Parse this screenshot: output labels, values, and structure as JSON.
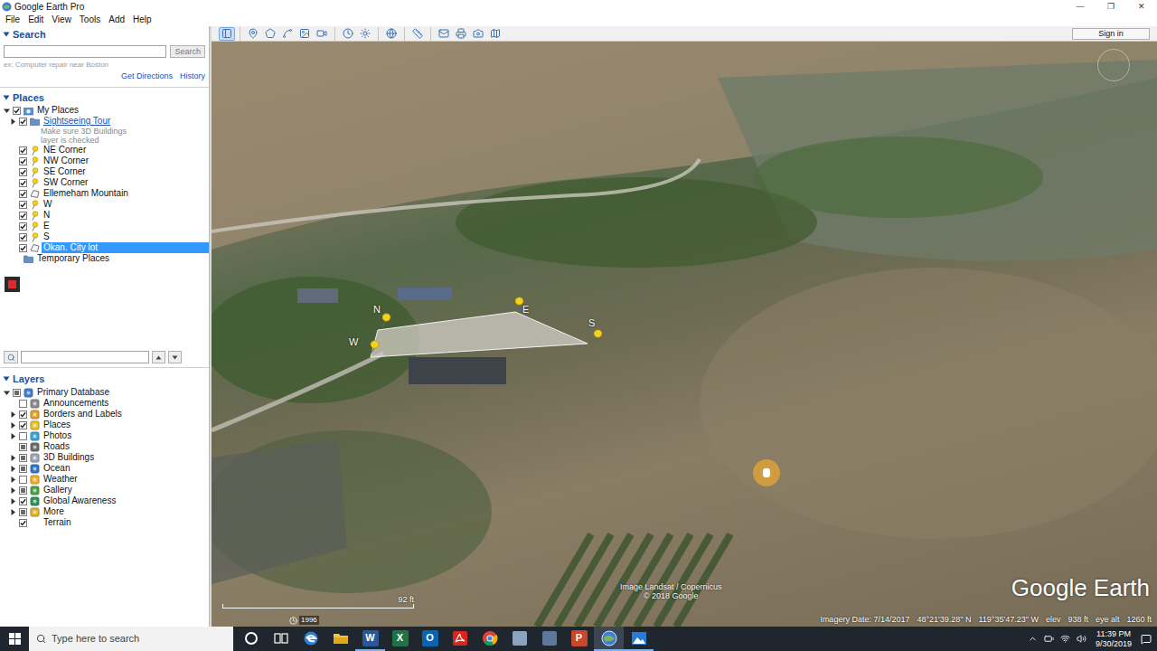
{
  "window": {
    "title": "Google Earth Pro",
    "controls": [
      "—",
      "❐",
      "✕"
    ]
  },
  "menu": [
    "File",
    "Edit",
    "View",
    "Tools",
    "Add",
    "Help"
  ],
  "search": {
    "title": "Search",
    "button": "Search",
    "hint": "ex: Computer repair near Boston",
    "links": [
      "Get Directions",
      "History"
    ]
  },
  "places": {
    "title": "Places",
    "items": [
      {
        "label": "My Places",
        "depth": 0,
        "kind": "places-folder",
        "check": "checked",
        "expandable": true,
        "expanded": true,
        "selected": false,
        "link": false,
        "note": []
      },
      {
        "label": "Sightseeing Tour",
        "depth": 1,
        "kind": "folder",
        "check": "checked",
        "expandable": true,
        "expanded": false,
        "selected": false,
        "link": true,
        "note": [
          "Make sure 3D Buildings",
          "layer is checked"
        ]
      },
      {
        "label": "NE Corner",
        "depth": 1,
        "kind": "pin",
        "check": "checked",
        "expandable": false,
        "expanded": false,
        "selected": false,
        "link": false,
        "note": []
      },
      {
        "label": "NW Corner",
        "depth": 1,
        "kind": "pin",
        "check": "checked",
        "expandable": false,
        "expanded": false,
        "selected": false,
        "link": false,
        "note": []
      },
      {
        "label": "SE Corner",
        "depth": 1,
        "kind": "pin",
        "check": "checked",
        "expandable": false,
        "expanded": false,
        "selected": false,
        "link": false,
        "note": []
      },
      {
        "label": "SW Corner",
        "depth": 1,
        "kind": "pin",
        "check": "checked",
        "expandable": false,
        "expanded": false,
        "selected": false,
        "link": false,
        "note": []
      },
      {
        "label": "Ellemeham Mountain",
        "depth": 1,
        "kind": "polygon",
        "check": "checked",
        "expandable": false,
        "expanded": false,
        "selected": false,
        "link": false,
        "note": []
      },
      {
        "label": "W",
        "depth": 1,
        "kind": "pin",
        "check": "checked",
        "expandable": false,
        "expanded": false,
        "selected": false,
        "link": false,
        "note": []
      },
      {
        "label": "N",
        "depth": 1,
        "kind": "pin",
        "check": "checked",
        "expandable": false,
        "expanded": false,
        "selected": false,
        "link": false,
        "note": []
      },
      {
        "label": "E",
        "depth": 1,
        "kind": "pin",
        "check": "checked",
        "expandable": false,
        "expanded": false,
        "selected": false,
        "link": false,
        "note": []
      },
      {
        "label": "S",
        "depth": 1,
        "kind": "pin",
        "check": "checked",
        "expandable": false,
        "expanded": false,
        "selected": false,
        "link": false,
        "note": []
      },
      {
        "label": "Okan. City lot",
        "depth": 1,
        "kind": "polygon",
        "check": "checked",
        "expandable": false,
        "expanded": false,
        "selected": true,
        "link": false,
        "note": []
      },
      {
        "label": "Temporary Places",
        "depth": 0,
        "kind": "folder",
        "check": "none",
        "expandable": false,
        "expanded": false,
        "selected": false,
        "link": false,
        "note": []
      }
    ]
  },
  "layers": {
    "title": "Layers",
    "items": [
      {
        "label": "Primary Database",
        "depth": 0,
        "kind": "database",
        "check": "partial",
        "expandable": true,
        "expanded": true,
        "selected": false,
        "link": false,
        "note": []
      },
      {
        "label": "Announcements",
        "depth": 1,
        "kind": "announce",
        "check": "unchecked",
        "expandable": false,
        "expanded": false,
        "selected": false,
        "link": false,
        "note": []
      },
      {
        "label": "Borders and Labels",
        "depth": 1,
        "kind": "borders",
        "check": "checked",
        "expandable": true,
        "expanded": false,
        "selected": false,
        "link": false,
        "note": []
      },
      {
        "label": "Places",
        "depth": 1,
        "kind": "places",
        "check": "checked",
        "expandable": true,
        "expanded": false,
        "selected": false,
        "link": false,
        "note": []
      },
      {
        "label": "Photos",
        "depth": 1,
        "kind": "photos",
        "check": "unchecked",
        "expandable": true,
        "expanded": false,
        "selected": false,
        "link": false,
        "note": []
      },
      {
        "label": "Roads",
        "depth": 1,
        "kind": "roads",
        "check": "partial",
        "expandable": false,
        "expanded": false,
        "selected": false,
        "link": false,
        "note": []
      },
      {
        "label": "3D Buildings",
        "depth": 1,
        "kind": "buildings",
        "check": "partial",
        "expandable": true,
        "expanded": false,
        "selected": false,
        "link": false,
        "note": []
      },
      {
        "label": "Ocean",
        "depth": 1,
        "kind": "ocean",
        "check": "partial",
        "expandable": true,
        "expanded": false,
        "selected": false,
        "link": false,
        "note": []
      },
      {
        "label": "Weather",
        "depth": 1,
        "kind": "weather",
        "check": "unchecked",
        "expandable": true,
        "expanded": false,
        "selected": false,
        "link": false,
        "note": []
      },
      {
        "label": "Gallery",
        "depth": 1,
        "kind": "gallery",
        "check": "partial",
        "expandable": true,
        "expanded": false,
        "selected": false,
        "link": false,
        "note": []
      },
      {
        "label": "Global Awareness",
        "depth": 1,
        "kind": "globe",
        "check": "checked",
        "expandable": true,
        "expanded": false,
        "selected": false,
        "link": false,
        "note": []
      },
      {
        "label": "More",
        "depth": 1,
        "kind": "more",
        "check": "partial",
        "expandable": true,
        "expanded": false,
        "selected": false,
        "link": false,
        "note": []
      },
      {
        "label": "Terrain",
        "depth": 1,
        "kind": "none",
        "check": "checked",
        "expandable": false,
        "expanded": false,
        "selected": false,
        "link": false,
        "note": []
      }
    ]
  },
  "toolbar": {
    "groups": [
      [
        {
          "kind": "sidebar",
          "selected": true
        }
      ],
      [
        {
          "kind": "placemark",
          "selected": false
        },
        {
          "kind": "polygon",
          "selected": false
        },
        {
          "kind": "path",
          "selected": false
        },
        {
          "kind": "overlay",
          "selected": false
        },
        {
          "kind": "tour",
          "selected": false
        }
      ],
      [
        {
          "kind": "history",
          "selected": false
        },
        {
          "kind": "sun",
          "selected": false
        }
      ],
      [
        {
          "kind": "planets",
          "selected": false
        }
      ],
      [
        {
          "kind": "ruler",
          "selected": false
        }
      ],
      [
        {
          "kind": "email",
          "selected": false
        },
        {
          "kind": "print",
          "selected": false
        },
        {
          "kind": "image",
          "selected": false
        },
        {
          "kind": "maps",
          "selected": false
        }
      ]
    ],
    "sign_in": "Sign in"
  },
  "map": {
    "pins": [
      {
        "label": "N"
      },
      {
        "label": "E"
      },
      {
        "label": "S"
      },
      {
        "label": "W"
      }
    ],
    "scale": "92 ft",
    "time_slider": "1996",
    "attribution": [
      "Image Landsat / Copernicus",
      "© 2018 Google"
    ],
    "logo": "Google Earth",
    "status": {
      "imagery_date": "Imagery Date: 7/14/2017",
      "lat": "48°21'39.28\" N",
      "lon": "119°35'47.23\" W",
      "elev_label": "elev",
      "elev": "938 ft",
      "eye_label": "eye alt",
      "eye": "1260 ft"
    }
  },
  "taskbar": {
    "search_placeholder": "Type here to search",
    "apps": [
      {
        "kind": "cortana",
        "glyph": "",
        "color": "#ffffff",
        "open": false,
        "active": false
      },
      {
        "kind": "taskview",
        "glyph": "",
        "color": "#ffffff",
        "open": false,
        "active": false
      },
      {
        "kind": "edge",
        "glyph": "",
        "color": "#2f7fd8",
        "open": false,
        "active": false
      },
      {
        "kind": "explorer",
        "glyph": "",
        "color": "#f2c240",
        "open": false,
        "active": false
      },
      {
        "kind": "tile",
        "glyph": "W",
        "color": "#2b579a",
        "open": true,
        "active": false
      },
      {
        "kind": "tile",
        "glyph": "X",
        "color": "#217346",
        "open": false,
        "active": false
      },
      {
        "kind": "tile",
        "glyph": "O",
        "color": "#0a64b4",
        "open": false,
        "active": false
      },
      {
        "kind": "acrobat",
        "glyph": "",
        "color": "#d8261d",
        "open": false,
        "active": false
      },
      {
        "kind": "chrome",
        "glyph": "",
        "color": "#4285f4",
        "open": false,
        "active": false
      },
      {
        "kind": "generic",
        "glyph": "",
        "color": "#8aa4c0",
        "open": false,
        "active": false
      },
      {
        "kind": "generic",
        "glyph": "",
        "color": "#5b7a99",
        "open": false,
        "active": false
      },
      {
        "kind": "tile",
        "glyph": "P",
        "color": "#c8482b",
        "open": false,
        "active": false
      },
      {
        "kind": "earth",
        "glyph": "",
        "color": "#3b7dd8",
        "open": true,
        "active": true
      },
      {
        "kind": "photos",
        "glyph": "",
        "color": "#2a7bd4",
        "open": true,
        "active": false
      }
    ],
    "time": "11:39 PM",
    "date": "9/30/2019"
  }
}
